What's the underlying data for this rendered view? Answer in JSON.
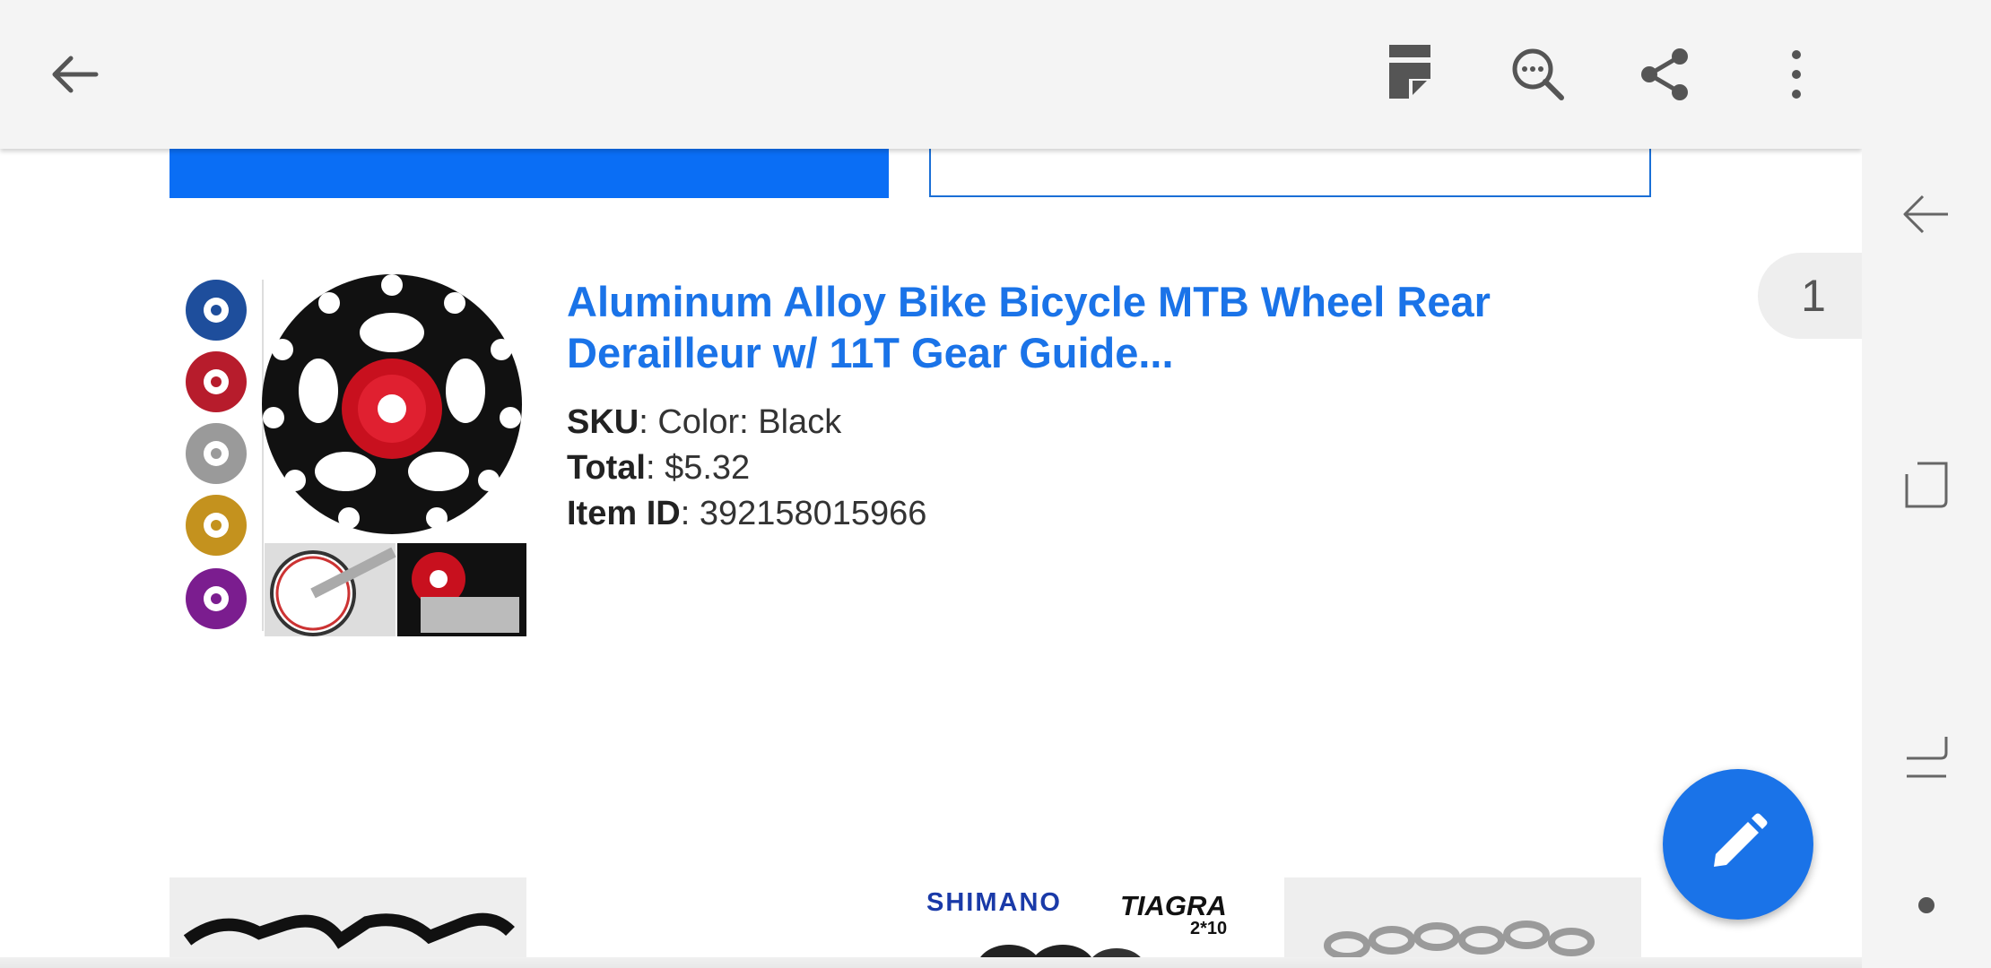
{
  "toolbar": {
    "back_icon": "arrow-left-icon",
    "reader_icon": "reader-mode-icon",
    "find_icon": "find-in-page-icon",
    "share_icon": "share-icon",
    "more_icon": "more-vert-icon"
  },
  "colors": {
    "accent": "#1a73e8",
    "primary_button": "#0a6ef5",
    "toolbar_bg": "#f4f4f4"
  },
  "item": {
    "title": "Aluminum Alloy Bike Bicycle MTB Wheel Rear Derailleur w/ 11T Gear Guide...",
    "sku_label": "SKU",
    "sku_value": ": Color: Black",
    "total_label": "Total",
    "total_value": ": $5.32",
    "id_label": "Item ID",
    "id_value": ": 392158015966"
  },
  "page_indicator": "1",
  "bottom_images": {
    "brand_left": "SHIMANO",
    "brand_right": "TIAGRA",
    "brand_sub": "2*10"
  },
  "sysnav": {
    "back_icon": "nav-back-icon",
    "recents_icon": "recents-icon",
    "home_icon": "home-gesture-icon",
    "dot_icon": "hide-nav-dot-icon"
  }
}
